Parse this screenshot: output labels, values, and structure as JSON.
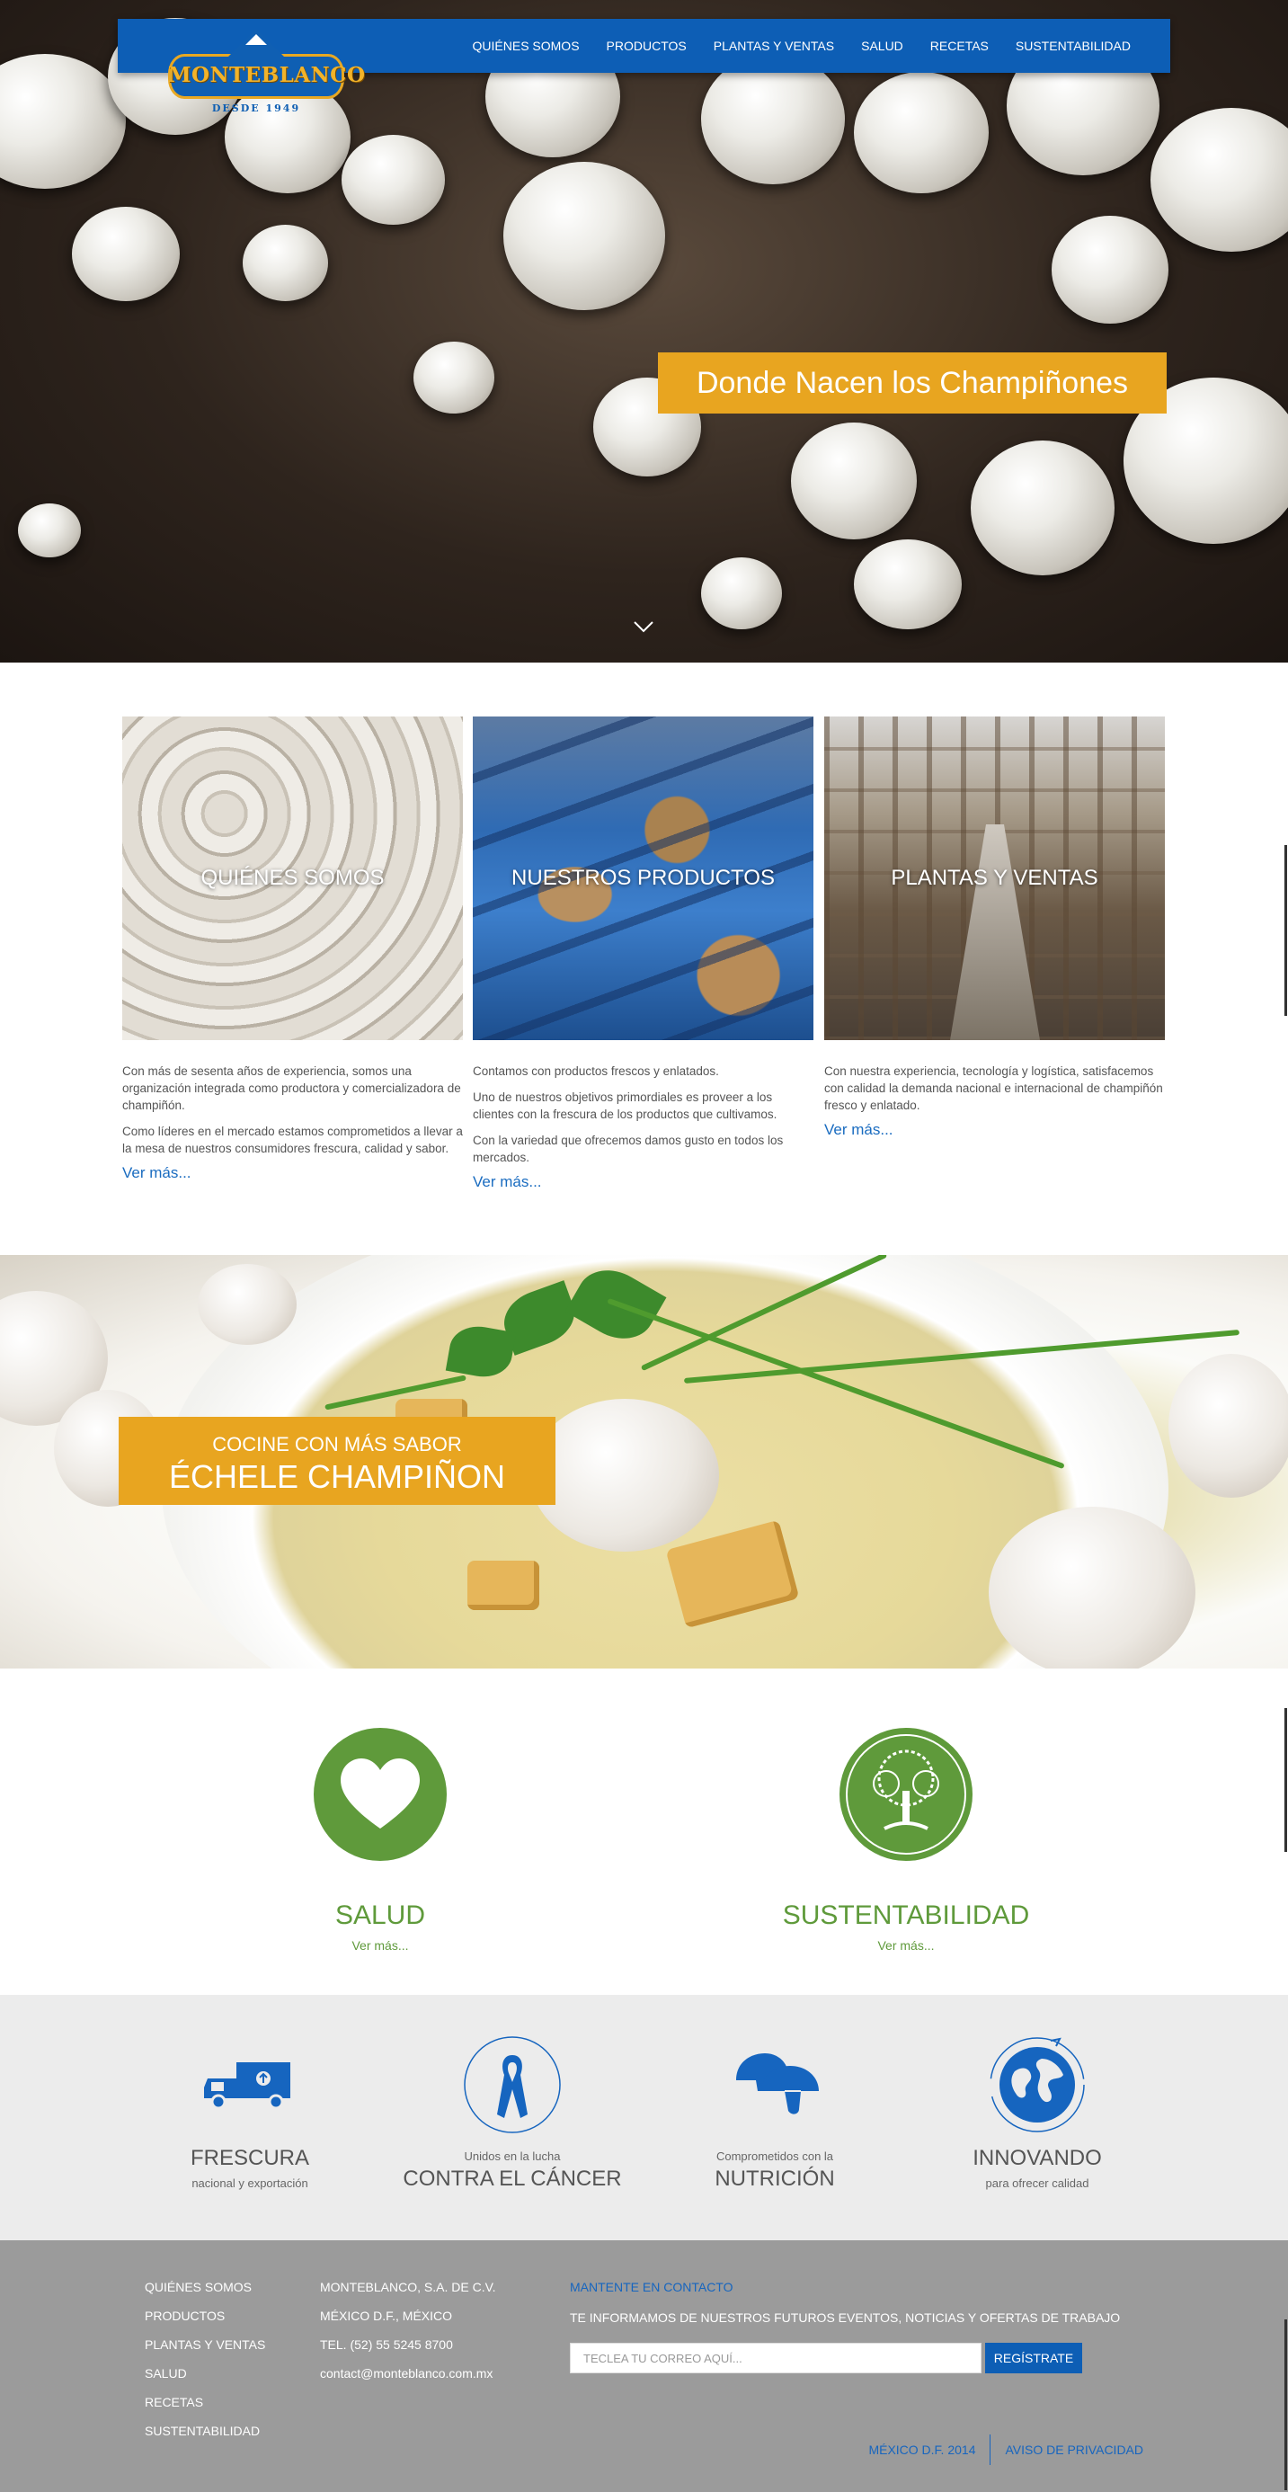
{
  "header": {
    "logo_text": "MONTEBLANCO",
    "logo_since": "DESDE 1949",
    "nav": [
      "QUIÉNES SOMOS",
      "PRODUCTOS",
      "PLANTAS Y VENTAS",
      "SALUD",
      "RECETAS",
      "SUSTENTABILIDAD"
    ],
    "brand_color": "#0d5eb5",
    "accent_color": "#e8a520"
  },
  "hero": {
    "banner": "Donde Nacen los Champiñones",
    "scroll_icon": "chevron-down-icon"
  },
  "sections": [
    {
      "title": "QUIÉNES SOMOS",
      "paragraphs": [
        "Con más de sesenta años de experiencia, somos una organización integrada como productora y comercializadora de champiñón.",
        "Como líderes en el mercado estamos comprometidos a llevar a la mesa de nuestros consumidores frescura, calidad y sabor."
      ],
      "more": "Ver más..."
    },
    {
      "title": "NUESTROS PRODUCTOS",
      "paragraphs": [
        "Contamos con productos frescos y enlatados.",
        "Uno de nuestros objetivos primordiales es proveer a los clientes con la frescura de los productos que cultivamos.",
        "Con la variedad que ofrecemos damos gusto en todos los mercados."
      ],
      "more": "Ver más..."
    },
    {
      "title": "PLANTAS Y VENTAS",
      "paragraphs": [
        "Con nuestra experiencia, tecnología y logística, satisfacemos con calidad la demanda nacional e internacional de champiñón fresco y enlatado."
      ],
      "more": "Ver más..."
    }
  ],
  "recipes_banner": {
    "line1": "COCINE CON MÁS SABOR",
    "line2": "ÉCHELE CHAMPIÑON"
  },
  "features": [
    {
      "icon": "heart-icon",
      "label": "SALUD",
      "more": "Ver más..."
    },
    {
      "icon": "tree-icon",
      "label": "SUSTENTABILIDAD",
      "more": "Ver más..."
    }
  ],
  "features_color": "#5f9a3b",
  "values": [
    {
      "icon": "truck-icon",
      "big": "FRESCURA",
      "small": "nacional y exportación"
    },
    {
      "icon": "ribbon-icon",
      "small": "Unidos en la lucha",
      "big": "CONTRA EL CÁNCER"
    },
    {
      "icon": "mushrooms-icon",
      "small": "Comprometidos con la",
      "big": "NUTRICIÓN"
    },
    {
      "icon": "globe-icon",
      "big": "INNOVANDO",
      "small": "para ofrecer calidad"
    }
  ],
  "footer": {
    "nav": [
      "QUIÉNES SOMOS",
      "PRODUCTOS",
      "PLANTAS Y VENTAS",
      "SALUD",
      "RECETAS",
      "SUSTENTABILIDAD"
    ],
    "contact": [
      "MONTEBLANCO, S.A. DE C.V.",
      "MÉXICO D.F., MÉXICO",
      "TEL. (52) 55 5245 8700",
      "contact@monteblanco.com.mx"
    ],
    "subscribe_heading": "MANTENTE EN CONTACTO",
    "subscribe_text": "TE INFORMAMOS DE NUESTROS FUTUROS EVENTOS, NOTICIAS Y OFERTAS DE TRABAJO",
    "email_placeholder": "TECLEA TU CORREO AQUÍ...",
    "register_button": "REGÍSTRATE",
    "copyright": "MÉXICO D.F. 2014",
    "privacy": "AVISO DE PRIVACIDAD"
  }
}
